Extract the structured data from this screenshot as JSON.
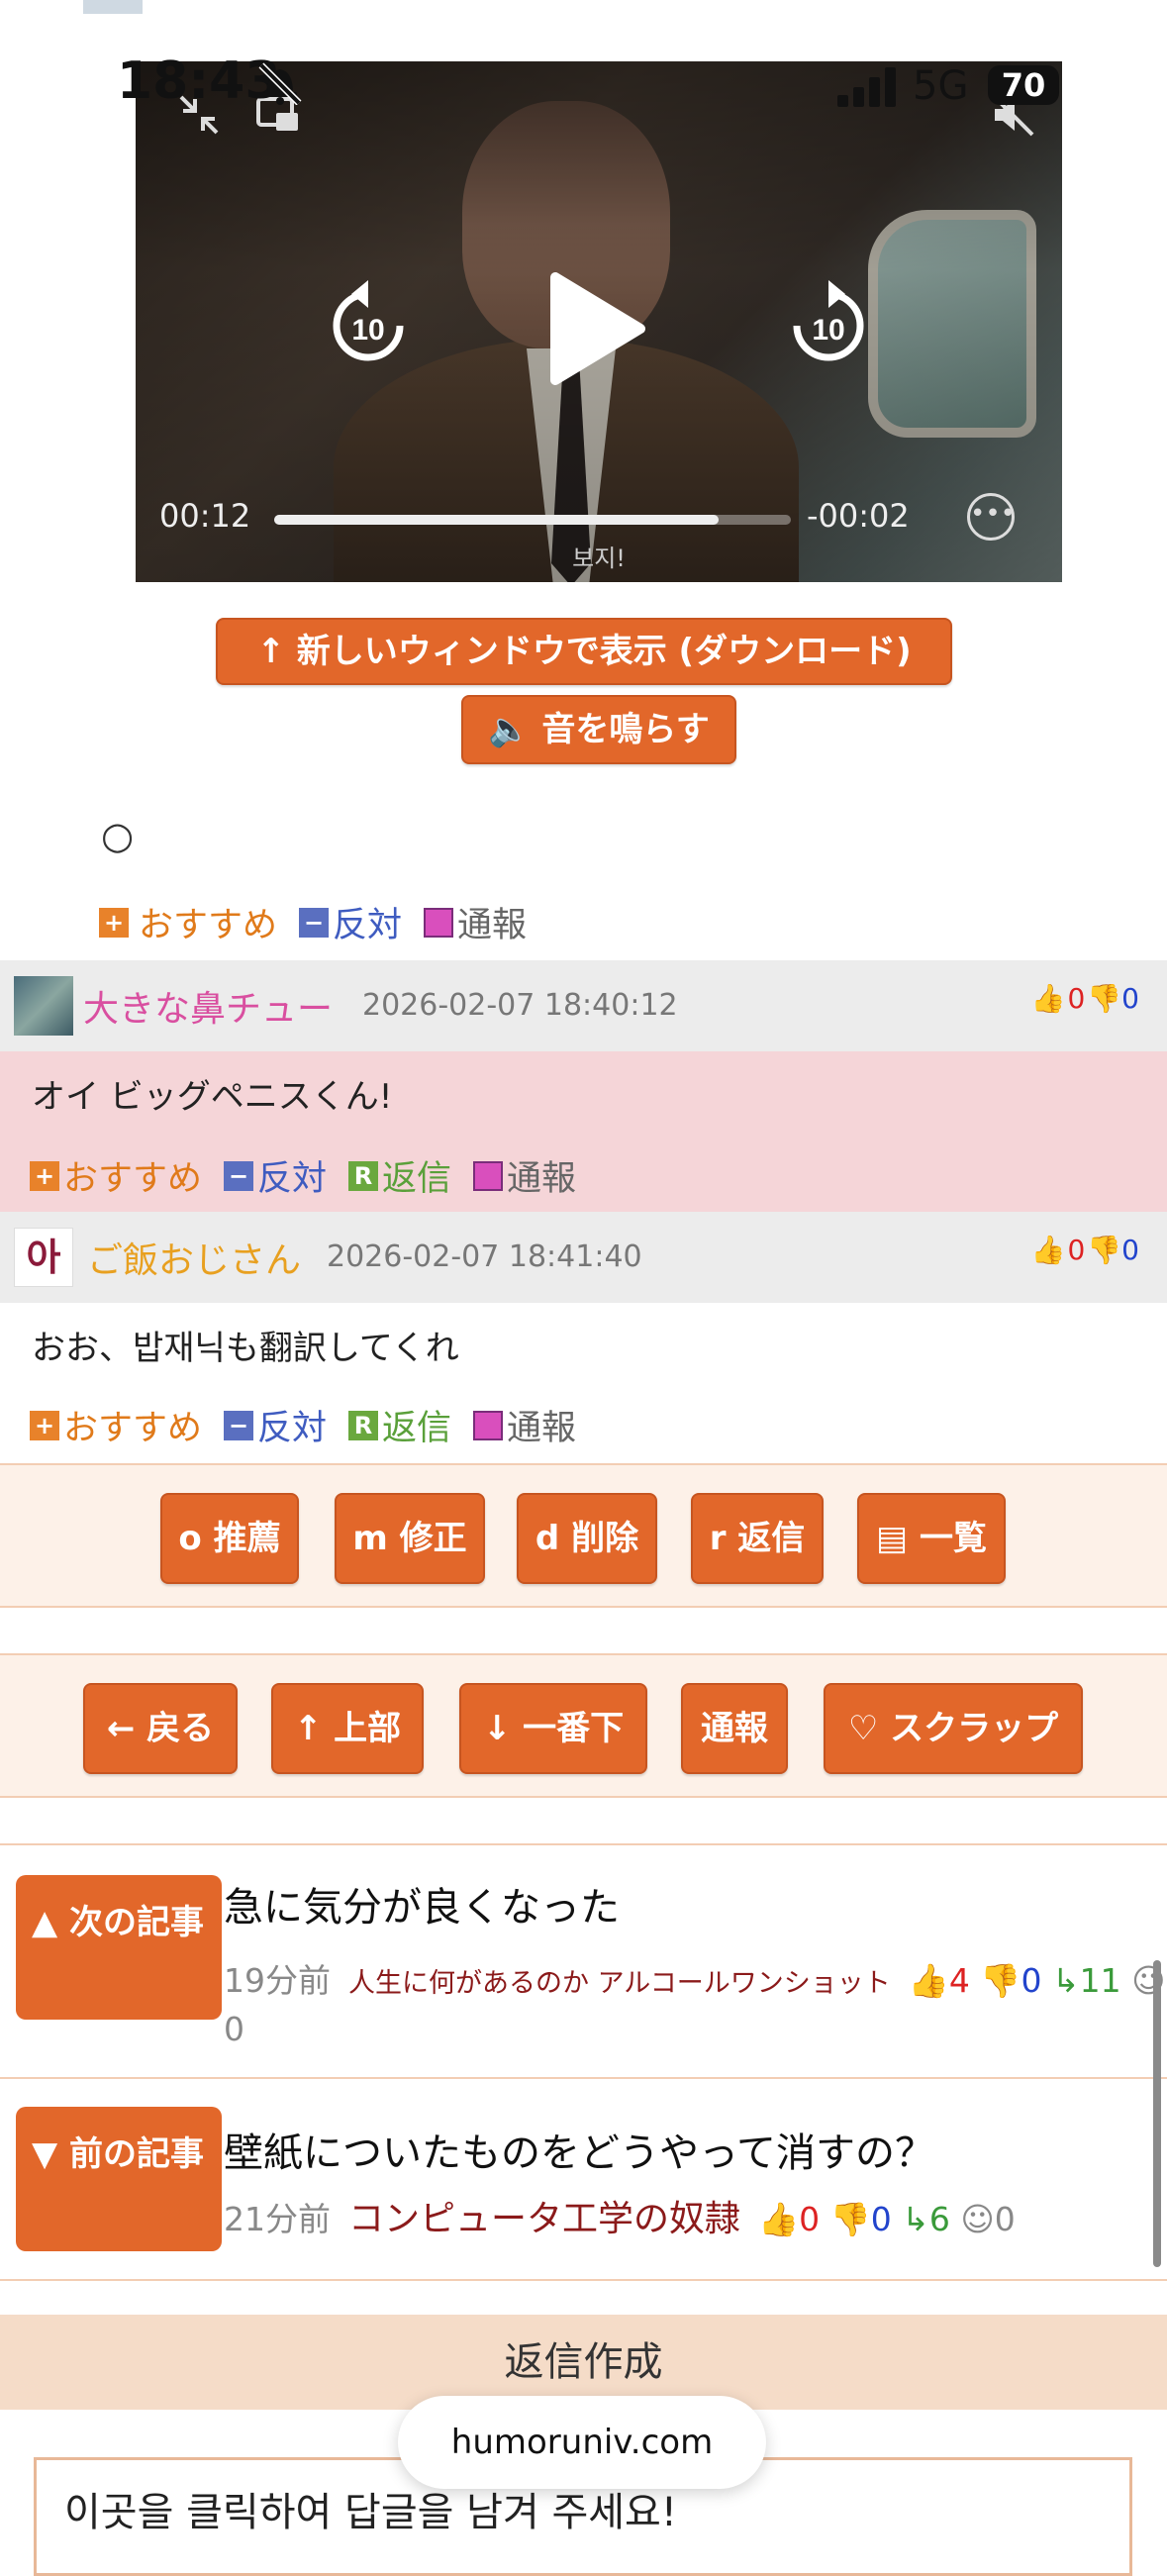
{
  "status_bar": {
    "time": "18:43",
    "network": "5G",
    "battery": "70"
  },
  "video": {
    "elapsed": "00:12",
    "remaining": "-00:02",
    "progress": 0.86,
    "caption": "보지!"
  },
  "buttons": {
    "new_window": "↑ 新しいウィンドウで表示 (ダウンロード)",
    "sound": "音を鳴らす"
  },
  "post": {
    "body": "○",
    "actions": {
      "recommend": "おすすめ",
      "oppose": "反対",
      "report": "通報"
    }
  },
  "comments": [
    {
      "author": "大きな鼻チュー",
      "author_color": "#d94fa0",
      "date": "2026-02-07 18:40:12",
      "up": "0",
      "down": "0",
      "body": "オイ ビッグペニスくん!",
      "highlight": "#f5d5d8",
      "actions": {
        "recommend": "おすすめ",
        "oppose": "反対",
        "reply": "返信",
        "report": "通報"
      }
    },
    {
      "author": "ご飯おじさん",
      "author_color": "#e8a020",
      "avatar_text": "아",
      "date": "2026-02-07 18:41:40",
      "up": "0",
      "down": "0",
      "body": "おお、밥재닉も翻訳してくれ",
      "actions": {
        "recommend": "おすすめ",
        "oppose": "反対",
        "reply": "返信",
        "report": "通報"
      }
    }
  ],
  "toolbar1": [
    {
      "key": "o",
      "label": "o 推薦"
    },
    {
      "key": "m",
      "label": "m 修正"
    },
    {
      "key": "d",
      "label": "d 削除"
    },
    {
      "key": "r",
      "label": "r 返信"
    },
    {
      "key": "list",
      "label": "▤ 一覧"
    }
  ],
  "toolbar2": [
    {
      "label": "← 戻る"
    },
    {
      "label": "↑ 上部"
    },
    {
      "label": "↓ 一番下"
    },
    {
      "label": "通報"
    },
    {
      "label": "♡ スクラップ"
    }
  ],
  "next_article": {
    "label": "▲ 次の記事",
    "title": "急に気分が良くなった",
    "time": "19分前",
    "author": "人生に何があるのか アルコールワンショット",
    "up": "4",
    "down": "0",
    "replies": "11",
    "views": "0"
  },
  "prev_article": {
    "label": "▼ 前の記事",
    "title": "壁紙についたものをどうやって消すの？",
    "time": "21分前",
    "author": "コンピュータ工学の奴隷",
    "up": "0",
    "down": "0",
    "replies": "6",
    "views": "0"
  },
  "reply": {
    "heading": "返信作成",
    "placeholder": "이곳을 클릭하여 답글을 남겨 주세요!"
  },
  "browser": {
    "url": "humoruniv.com"
  },
  "colors": {
    "accent": "#e2672a",
    "band": "#fdf1e8"
  }
}
